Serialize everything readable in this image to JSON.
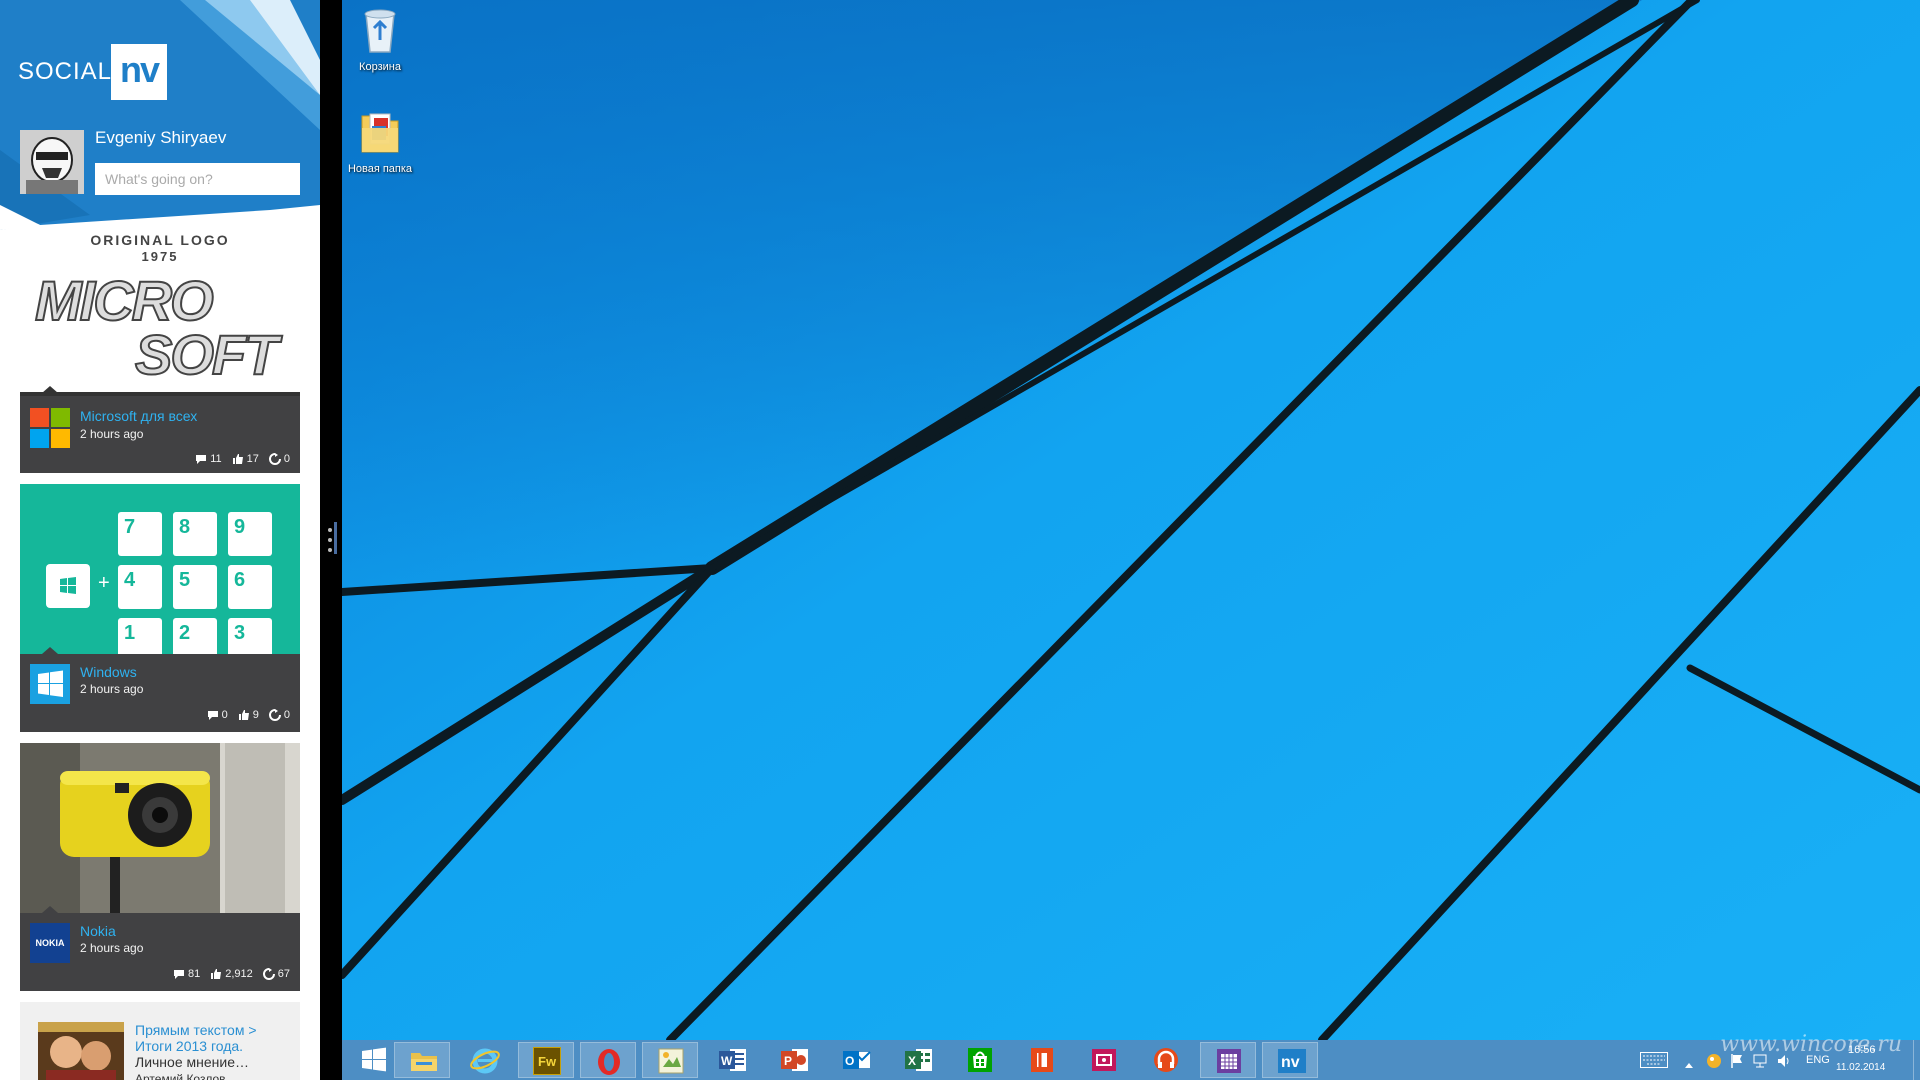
{
  "sidebar": {
    "brand": {
      "text": "SOCIAL",
      "box": "nv"
    },
    "user": {
      "name": "Evgeniy  Shiryaev",
      "status_placeholder": "What's going on?"
    },
    "feed": [
      {
        "image": {
          "caption_line1": "ORIGINAL LOGO",
          "caption_line2": "1975",
          "logo_line1": "MICRO",
          "logo_line2": "SOFT"
        },
        "source": "Microsoft",
        "source_suffix": " для всех",
        "time": "2 hours ago",
        "comments": "11",
        "likes": "17",
        "reposts": "0"
      },
      {
        "image": {
          "keys": [
            "7",
            "8",
            "9",
            "4",
            "5",
            "6",
            "1",
            "2",
            "3"
          ],
          "plus": "+"
        },
        "source": "Windows",
        "time": "2 hours ago",
        "comments": "0",
        "likes": "9",
        "reposts": "0"
      },
      {
        "source": "Nokia",
        "icon_text": "NOKIA",
        "time": "2 hours ago",
        "comments": "81",
        "likes": "2,912",
        "reposts": "67"
      }
    ],
    "bottom_post": {
      "text_line1": "Прямым текстом >",
      "text_line2": "Итоги 2013 года.",
      "text_line3": "Личное мнение…",
      "author": "Артемий Козлов"
    }
  },
  "desktop": {
    "icons": [
      {
        "label": "Корзина",
        "icon": "recycle-bin-icon"
      },
      {
        "label": "Новая папка",
        "icon": "folder-icon"
      }
    ]
  },
  "taskbar": {
    "apps": [
      {
        "id": "start",
        "icon": "windows-start-icon"
      },
      {
        "id": "explorer",
        "icon": "file-explorer-icon"
      },
      {
        "id": "ie",
        "icon": "internet-explorer-icon"
      },
      {
        "id": "fireworks",
        "icon": "fireworks-icon",
        "text": "Fw"
      },
      {
        "id": "opera",
        "icon": "opera-icon"
      },
      {
        "id": "image-app",
        "icon": "image-app-icon"
      },
      {
        "id": "word",
        "icon": "word-icon",
        "text": "W"
      },
      {
        "id": "powerpoint",
        "icon": "powerpoint-icon",
        "text": "P"
      },
      {
        "id": "outlook",
        "icon": "outlook-icon",
        "text": "O"
      },
      {
        "id": "excel",
        "icon": "excel-icon",
        "text": "X"
      },
      {
        "id": "store",
        "icon": "store-icon"
      },
      {
        "id": "office-app",
        "icon": "office-icon"
      },
      {
        "id": "screen-app",
        "icon": "screen-capture-icon"
      },
      {
        "id": "music-app",
        "icon": "headphones-icon"
      },
      {
        "id": "calendar-app",
        "icon": "calendar-icon"
      },
      {
        "id": "socialnv",
        "icon": "nv-icon",
        "text": "nv"
      }
    ],
    "tray": {
      "language": "ENG",
      "time": "16:56",
      "date": "11.02.2014"
    }
  },
  "watermark": "www.wincore.ru",
  "colors": {
    "header_blue": "#1f7fc8",
    "desktop_blue": "#12a2ee",
    "taskbar": "#4d8ec4",
    "link_blue": "#2fb2f0"
  }
}
